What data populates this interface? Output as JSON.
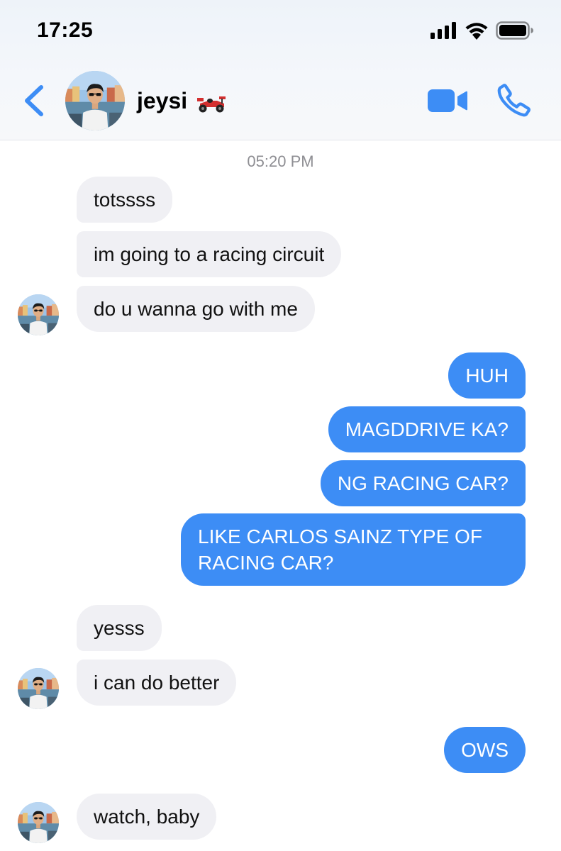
{
  "status_bar": {
    "time": "17:25"
  },
  "header": {
    "contact_name": "jeysi",
    "name_emoji": "racing-car-emoji",
    "back_icon": "chevron-left-icon",
    "video_icon": "video-camera-icon",
    "call_icon": "phone-icon"
  },
  "conversation": {
    "timestamp": "05:20 PM",
    "messages": [
      {
        "sender": "them",
        "text": "totssss"
      },
      {
        "sender": "them",
        "text": "im going to a racing circuit"
      },
      {
        "sender": "them",
        "text": "do u wanna go with me"
      },
      {
        "sender": "me",
        "text": "HUH"
      },
      {
        "sender": "me",
        "text": "MAGDDRIVE KA?"
      },
      {
        "sender": "me",
        "text": "NG RACING CAR?"
      },
      {
        "sender": "me",
        "text": "LIKE CARLOS SAINZ TYPE OF\nRACING CAR?"
      },
      {
        "sender": "them",
        "text": "yesss"
      },
      {
        "sender": "them",
        "text": "i can do better"
      },
      {
        "sender": "me",
        "text": "OWS"
      },
      {
        "sender": "them",
        "text": "watch, baby"
      }
    ]
  },
  "colors": {
    "accent": "#3d8df5",
    "incoming_bubble": "#f0f0f4",
    "timestamp": "#8e8e93"
  }
}
